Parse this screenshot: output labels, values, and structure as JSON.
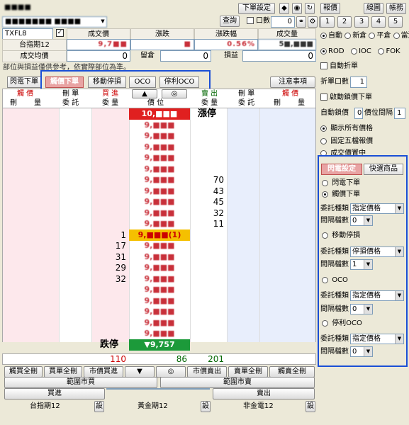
{
  "header": {
    "title_blur": "■■■■",
    "account_blur": "■■■■■■■ ■■■■",
    "query": "查詢",
    "order_setting": "下單設定",
    "quote": "報價",
    "lines": "線圖",
    "account": "帳務",
    "lots_label": "口數",
    "lots_value": "0",
    "c_label": "C",
    "page_nums": [
      "1",
      "2",
      "3",
      "4",
      "5"
    ]
  },
  "contract": {
    "symbol": "TXFL8",
    "cols": [
      "成交價",
      "漲跌",
      "漲跌幅",
      "成交量"
    ],
    "name": "台指期12",
    "price": "9,7■■",
    "change": "■",
    "pct": "0.56%",
    "volume": "5■,■■■",
    "avg_label": "成交均價",
    "avg_value": "0",
    "keep_label": "留倉",
    "keep_value": "0",
    "pnl_label": "損益",
    "pnl_value": "0",
    "note": "部位與損益僅供參考，依實際部位為準。"
  },
  "tabs": [
    "閃電下單",
    "觸價下單",
    "移動停損",
    "OCO",
    "停利OCO"
  ],
  "notice": "注意事項",
  "grid_headers": {
    "touch_buy": "觸 價",
    "touch_buy_sub": [
      "刪",
      "量"
    ],
    "del_buy": "刪 單",
    "del_buy_sub": "委 託",
    "buy": "買 進",
    "buy_sub": "委 量",
    "up": "▲",
    "target": "◎",
    "price": "價 位",
    "sell": "賣 出",
    "sell_sub": "委 量",
    "del_sell": "刪 單",
    "del_sell_sub": "委 託",
    "touch_sell": "觸 價",
    "touch_sell_sub": [
      "刪",
      "量"
    ]
  },
  "rows": [
    {
      "price": "10,■■■",
      "buy": "",
      "sell": "漲停",
      "style": "limitup"
    },
    {
      "price": "9,■■■",
      "buy": "",
      "sell": ""
    },
    {
      "price": "9,■■■",
      "buy": "",
      "sell": ""
    },
    {
      "price": "9,■■■",
      "buy": "",
      "sell": ""
    },
    {
      "price": "9,■■■",
      "buy": "",
      "sell": ""
    },
    {
      "price": "9,■■■",
      "buy": "",
      "sell": ""
    },
    {
      "price": "9,■■■",
      "buy": "",
      "sell": "70"
    },
    {
      "price": "9,■■■",
      "buy": "",
      "sell": "43"
    },
    {
      "price": "9,■■■",
      "buy": "",
      "sell": "45"
    },
    {
      "price": "9,■■■",
      "buy": "",
      "sell": "32"
    },
    {
      "price": "9,■■■",
      "buy": "",
      "sell": "11"
    },
    {
      "price": "9,■■■(1)",
      "buy": "1",
      "sell": "",
      "style": "current"
    },
    {
      "price": "9,■■■",
      "buy": "17",
      "sell": ""
    },
    {
      "price": "9,■■■",
      "buy": "31",
      "sell": ""
    },
    {
      "price": "9,■■■",
      "buy": "29",
      "sell": ""
    },
    {
      "price": "9,■■■",
      "buy": "32",
      "sell": ""
    },
    {
      "price": "9,■■■",
      "buy": "",
      "sell": ""
    },
    {
      "price": "9,■■■",
      "buy": "",
      "sell": ""
    },
    {
      "price": "9,■■■",
      "buy": "",
      "sell": ""
    },
    {
      "price": "9,■■■",
      "buy": "",
      "sell": ""
    },
    {
      "price": "9,■■■",
      "buy": "",
      "sell": ""
    },
    {
      "price": "▼9,757",
      "buy": "跌停",
      "sell": "",
      "style": "limitdown"
    }
  ],
  "totals": {
    "buy": "110",
    "mid": "86",
    "sell": "201"
  },
  "bottom_buttons": [
    "觸買全刪",
    "買單全刪",
    "市價買進",
    "▼",
    "◎",
    "市價賣出",
    "賣單全刪",
    "觸賣全刪"
  ],
  "range_buy": "範圍市買",
  "range_sell": "範圍市賣",
  "buy_btn": "買進",
  "sell_btn": "賣出",
  "footer": [
    {
      "name": "台指期12",
      "btn": "設"
    },
    {
      "name": "黃金期12",
      "btn": "設"
    },
    {
      "name": "非金電12",
      "btn": "設"
    }
  ],
  "right": {
    "mode_opts": [
      "自動",
      "新倉",
      "平倉",
      "當沖"
    ],
    "tif_opts": [
      "ROD",
      "IOC",
      "FOK"
    ],
    "auto_qty": "自動折單",
    "split_qty": "折單口數",
    "split_value": "1",
    "auto_reverse": "啟動鎖價下單",
    "auto_lock": "自動鎖價",
    "lock_value": "0",
    "gap_label": "價位間隔",
    "gap_value": "1",
    "show_all": "顯示所有價格",
    "fixed5": "固定五檔報價",
    "trade_center": "成交價置中",
    "panel_tabs": [
      "閃電設定",
      "快選商品"
    ],
    "flash": "閃電下單",
    "touch": "觸價下單",
    "order_type_label": "委託種類",
    "order_type_value": "指定價格",
    "gap_ticks_label": "間隔檔數",
    "gap_ticks_value": "0",
    "move_stop": "移動停損",
    "stop_price": "停損價格",
    "move_gap": "1",
    "oco": "OCO",
    "oco_type": "指定價格",
    "oco_gap": "0",
    "tp_oco": "停利OCO",
    "tp_type": "指定價格",
    "tp_gap": "0"
  }
}
